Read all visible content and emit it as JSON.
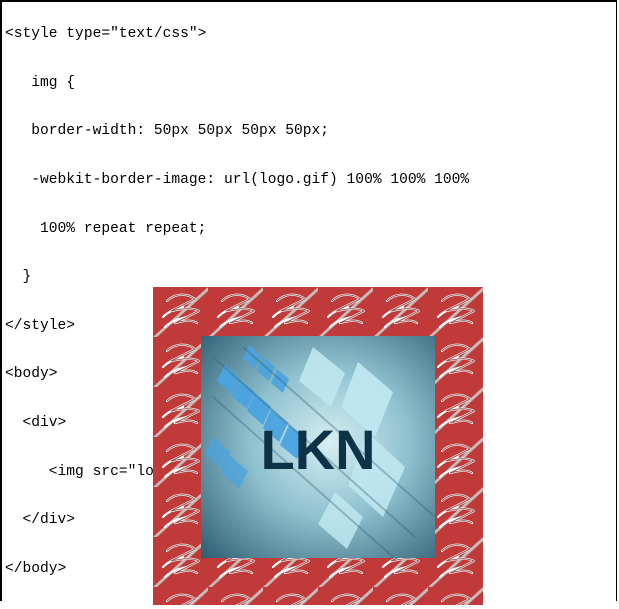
{
  "code_lines": [
    "<style type=\"text/css\">",
    "   img {",
    "   border-width: 50px 50px 50px 50px;",
    "   -webkit-border-image: url(logo.gif) 100% 100% 100%",
    "    100% repeat repeat;",
    "  }",
    "</style>",
    "<body>",
    "  <div>",
    "     <img src=\"logo.jpg\">",
    "  </div>",
    "</body>"
  ],
  "logo": {
    "text": "LKN"
  },
  "colors": {
    "border_red": "#c03a3a",
    "tile_gray": "#c8c8c8",
    "logo_text": "#0f3346",
    "logo_bg_center": "#d7eef3",
    "logo_bg_edge": "#2f5f73",
    "accent_blue": "#4aa3df",
    "pale_blue": "#bfe7f0"
  },
  "icons": {
    "border_tile": "scribble-tile"
  }
}
